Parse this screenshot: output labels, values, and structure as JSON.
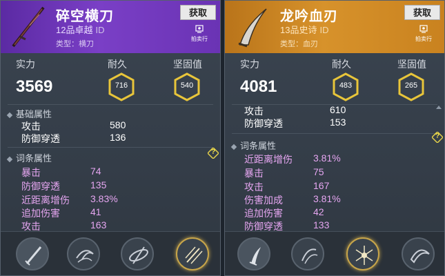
{
  "cards": [
    {
      "name": "碎空横刀",
      "grade": "12品卓越",
      "id_label": "ID",
      "type": "类型：横刀",
      "get_label": "获取",
      "auction_label": "拍卖行",
      "accent": "#7a3fc6",
      "stats": {
        "power_label": "实力",
        "power": "3569",
        "durability_label": "耐久",
        "durability": "716",
        "solidity_label": "坚固值",
        "solidity": "540"
      },
      "base_title": "基础属性",
      "base": [
        {
          "k": "攻击",
          "v": "580"
        },
        {
          "k": "防御穿透",
          "v": "136"
        }
      ],
      "affix_title": "词条属性",
      "affix": [
        {
          "k": "暴击",
          "v": "74"
        },
        {
          "k": "防御穿透",
          "v": "135"
        },
        {
          "k": "近距离增伤",
          "v": "3.83%"
        },
        {
          "k": "追加伤害",
          "v": "41"
        },
        {
          "k": "攻击",
          "v": "163"
        }
      ],
      "help_glyph": "?",
      "tray_icons": [
        "sword-icon",
        "swirl-icon",
        "spin-icon",
        "slash-icon"
      ]
    },
    {
      "name": "龙吟血刃",
      "grade": "13品史诗",
      "id_label": "ID",
      "type": "类型：血刃",
      "get_label": "获取",
      "auction_label": "拍卖行",
      "accent": "#d7922b",
      "stats": {
        "power_label": "实力",
        "power": "4081",
        "durability_label": "耐久",
        "durability": "483",
        "solidity_label": "坚固值",
        "solidity": "265"
      },
      "base_title": "",
      "base": [
        {
          "k": "攻击",
          "v": "610"
        },
        {
          "k": "防御穿透",
          "v": "153"
        }
      ],
      "affix_title": "词条属性",
      "affix": [
        {
          "k": "近距离增伤",
          "v": "3.81%"
        },
        {
          "k": "暴击",
          "v": "75"
        },
        {
          "k": "攻击",
          "v": "167"
        },
        {
          "k": "伤害加成",
          "v": "3.81%"
        },
        {
          "k": "追加伤害",
          "v": "42"
        },
        {
          "k": "防御穿透",
          "v": "133"
        }
      ],
      "help_glyph": "?",
      "tray_icons": [
        "dagger-icon",
        "talon-icon",
        "burst-icon",
        "crescent-icon"
      ]
    }
  ]
}
